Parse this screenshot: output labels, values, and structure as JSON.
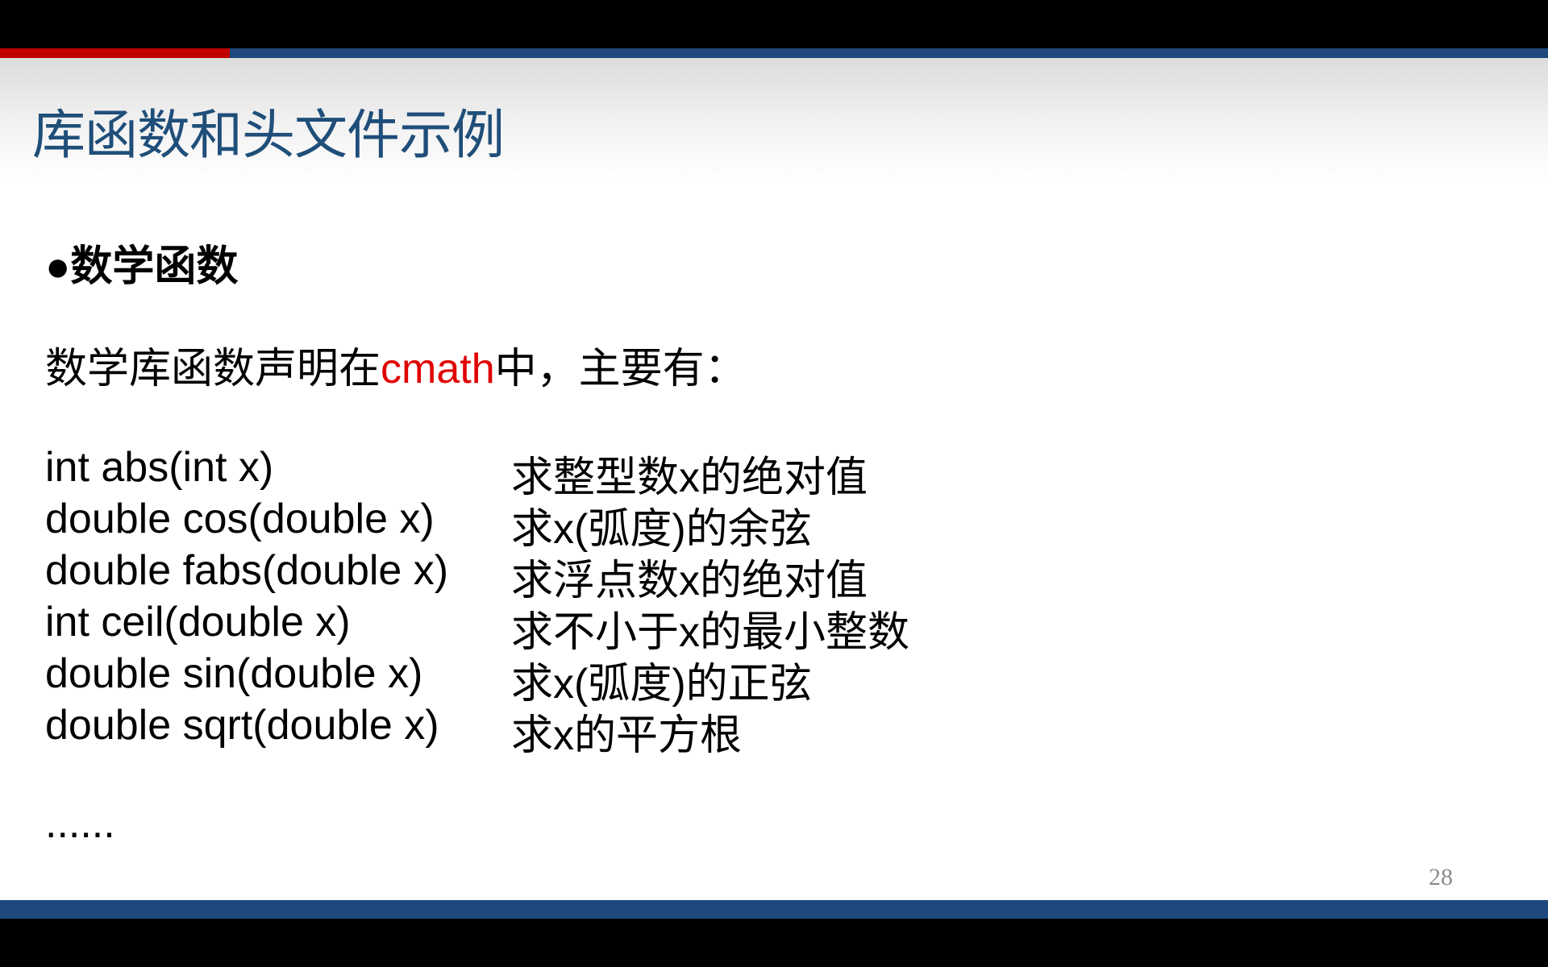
{
  "slide": {
    "title": "库函数和头文件示例",
    "bullet_glyph": "●",
    "section_heading": "数学函数",
    "intro_before": "数学库函数声明在",
    "intro_keyword": "cmath",
    "intro_after": "中，主要有：",
    "functions": [
      {
        "signature": "int abs(int x)",
        "description": "求整型数x的绝对值"
      },
      {
        "signature": "double cos(double x)",
        "description": "求x(弧度)的余弦"
      },
      {
        "signature": "double fabs(double x)",
        "description": "求浮点数x的绝对值"
      },
      {
        "signature": "int ceil(double x)",
        "description": "求不小于x的最小整数"
      },
      {
        "signature": "double sin(double x)",
        "description": "求x(弧度)的正弦"
      },
      {
        "signature": "double sqrt(double x)",
        "description": "求x的平方根"
      }
    ],
    "ellipsis": "......",
    "page_number": "28"
  },
  "colors": {
    "title": "#1f4e79",
    "accent_red": "#c00000",
    "bar_blue": "#1f497d",
    "keyword_red": "#e00000"
  }
}
